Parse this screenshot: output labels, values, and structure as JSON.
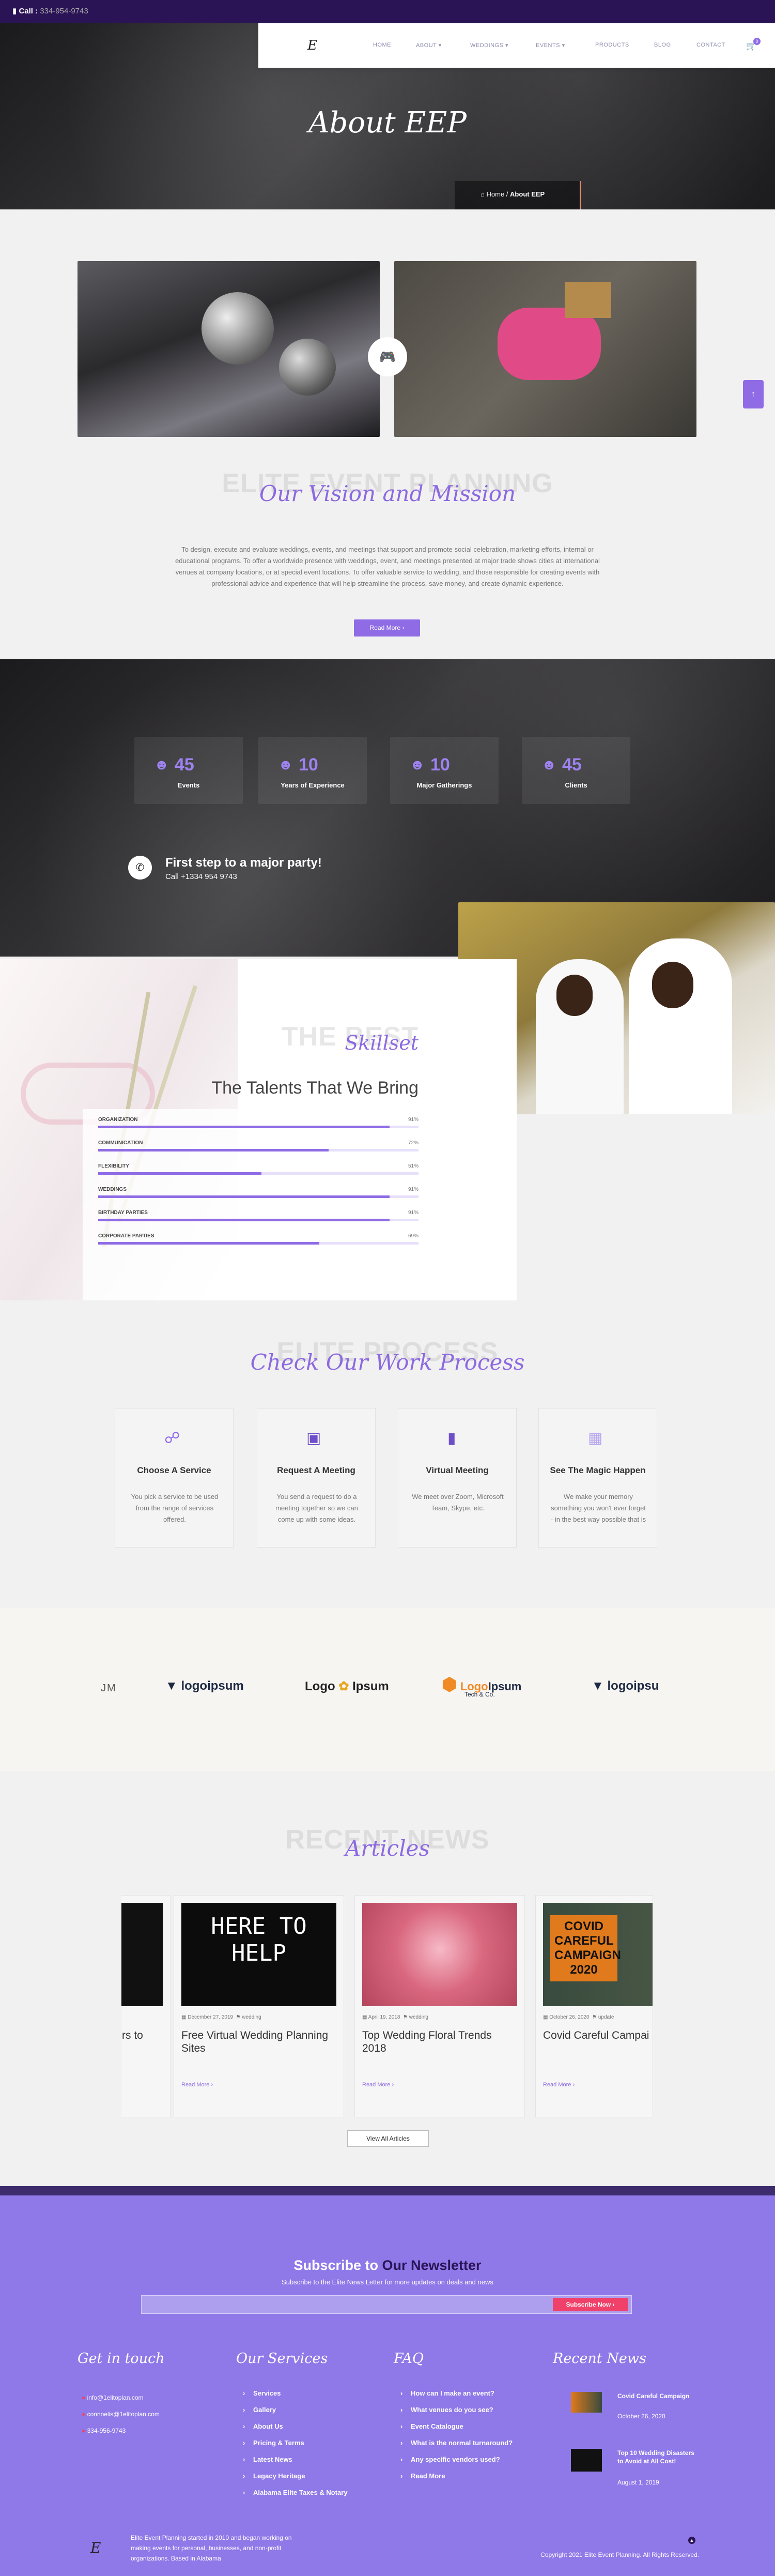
{
  "colors": {
    "accent": "#8f6ce5",
    "topbar": "#2a1456",
    "footer": "#8f79e8"
  },
  "topbar": {
    "call_label": "Call :",
    "phone": "334-954-9743"
  },
  "nav": {
    "logo": "E",
    "items": [
      "HOME",
      "ABOUT ▾",
      "WEDDINGS ▾",
      "EVENTS ▾",
      "PRODUCTS",
      "BLOG",
      "CONTACT"
    ],
    "cart_count": "0"
  },
  "hero": {
    "title": "About EEP",
    "breadcrumb_home": "Home",
    "breadcrumb_sep": "/",
    "breadcrumb_current": "About EEP"
  },
  "vision": {
    "bg_heading": "ELITE EVENT PLANNING",
    "heading": "Our Vision and Mission",
    "body": "To design, execute and evaluate weddings, events, and meetings that support and promote social celebration, marketing efforts, internal or educational programs. To offer a worldwide presence with weddings, event, and meetings presented at major trade shows cities at international venues at company locations, or at special event locations. To offer valuable service to wedding, and those responsible for creating events with professional advice and experience that will help streamline the process, save money, and create dynamic experience.",
    "button": "Read More ›"
  },
  "stats": [
    {
      "value": "45",
      "label": "Events"
    },
    {
      "value": "10",
      "label": "Years of Experience"
    },
    {
      "value": "10",
      "label": "Major Gatherings"
    },
    {
      "value": "45",
      "label": "Clients"
    }
  ],
  "cta": {
    "title": "First step to a major party!",
    "phone": "Call +1334 954 9743"
  },
  "skills": {
    "bg_heading": "THE BEST",
    "script": "Skillset",
    "heading": "The Talents That We Bring",
    "items": [
      {
        "label": "ORGANIZATION",
        "value": "91%",
        "pct": 91
      },
      {
        "label": "COMMUNICATION",
        "value": "72%",
        "pct": 72
      },
      {
        "label": "FLEXIBILITY",
        "value": "51%",
        "pct": 51
      },
      {
        "label": "WEDDINGS",
        "value": "91%",
        "pct": 91
      },
      {
        "label": "BIRTHDAY PARTIES",
        "value": "91%",
        "pct": 91
      },
      {
        "label": "CORPORATE PARTIES",
        "value": "69%",
        "pct": 69
      }
    ]
  },
  "process": {
    "bg_heading": "ELITE PROCESS",
    "heading": "Check Our Work Process",
    "steps": [
      {
        "title": "Choose A Service",
        "text": "You pick a service to be used from the range of services offered.",
        "icon": "headset-icon"
      },
      {
        "title": "Request A Meeting",
        "text": "You send a request to do a meeting together so we can come up with some ideas.",
        "icon": "box-icon"
      },
      {
        "title": "Virtual Meeting",
        "text": "We meet over Zoom, Microsoft Team, Skype, etc.",
        "icon": "video-call-icon"
      },
      {
        "title": "See The Magic Happen",
        "text": "We make your memory something you won't ever forget - in the best way possible that is",
        "icon": "calendar-icon"
      }
    ]
  },
  "logos": {
    "partial_left": "JM",
    "l1": "logoipsum",
    "l2a": "Logo",
    "l2b": "Ipsum",
    "l3a": "Logo",
    "l3b": "Ipsum",
    "l3c": "Tech & Co.",
    "l4": "logoipsu"
  },
  "news": {
    "bg_heading": "RECENT NEWS",
    "heading": "Articles",
    "partial_title": "rs to",
    "articles": [
      {
        "date": "December 27, 2019",
        "tag": "wedding",
        "title": "Free Virtual Wedding Planning Sites",
        "more": "Read More ›",
        "img_text": "HERE TO HELP"
      },
      {
        "date": "April 19, 2018",
        "tag": "wedding",
        "title": "Top Wedding Floral Trends 2018",
        "more": "Read More ›"
      },
      {
        "date": "October 26, 2020",
        "tag": "update",
        "title": "Covid Careful Campai",
        "more": "Read More ›",
        "img_text": "COVID CAREFUL CAMPAIGN 2020"
      }
    ],
    "view_all": "View All Articles"
  },
  "newsletter": {
    "title_a": "Subscribe to",
    "title_b": "Our Newsletter",
    "subtitle": "Subscribe to the Elite News Letter for more updates on deals and news",
    "button": "Subscribe Now ›"
  },
  "footer": {
    "get_in_touch": {
      "title": "Get in touch",
      "email1": "info@1elitoplan.com",
      "email2": "connoelis@1elitoplan.com",
      "phone": "334-956-9743"
    },
    "services": {
      "title": "Our Services",
      "items": [
        "Services",
        "Gallery",
        "About Us",
        "Pricing & Terms",
        "Latest News",
        "Legacy Heritage",
        "Alabama Elite Taxes & Notary"
      ]
    },
    "faq": {
      "title": "FAQ",
      "items": [
        "How can I make an event?",
        "What venues do you see?",
        "Event Catalogue",
        "What is the normal turnaround?",
        "Any specific vendors used?",
        "Read More"
      ]
    },
    "recent": {
      "title": "Recent News",
      "items": [
        {
          "title": "Covid Careful Campaign",
          "date": "October 26, 2020"
        },
        {
          "title": "Top 10 Wedding Disasters to Avoid at All Cost!",
          "date": "August 1, 2019"
        }
      ]
    },
    "about": "Elite Event Planning started in 2010 and began working on making events for personal, businesses, and non-profit organizations. Based in Alabama",
    "copyright": "Copyright 2021 Elite Event Planning. All Rights Reserved."
  }
}
